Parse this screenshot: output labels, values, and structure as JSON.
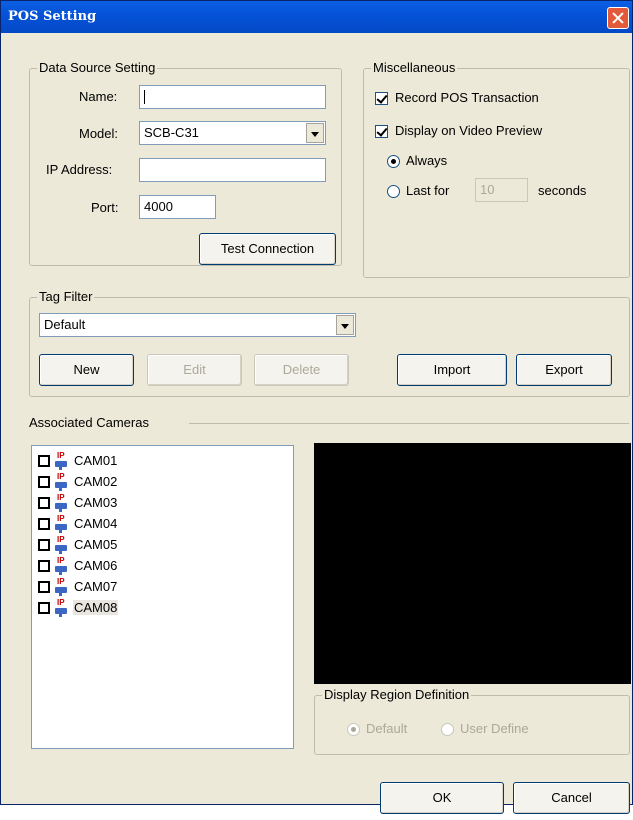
{
  "window": {
    "title": "POS Setting"
  },
  "data_source": {
    "legend": "Data Source Setting",
    "name_label": "Name:",
    "name_value": "",
    "model_label": "Model:",
    "model_value": "SCB-C31",
    "ip_label": "IP Address:",
    "ip_value": "",
    "port_label": "Port:",
    "port_value": "4000",
    "test_button": "Test Connection"
  },
  "misc": {
    "legend": "Miscellaneous",
    "record_pos": {
      "label": "Record POS Transaction",
      "checked": true
    },
    "display_preview": {
      "label": "Display on Video Preview",
      "checked": true
    },
    "always": {
      "label": "Always",
      "checked": true
    },
    "last_for": {
      "label": "Last for",
      "checked": false
    },
    "seconds_value": "10",
    "seconds_label": "seconds"
  },
  "tag_filter": {
    "legend": "Tag Filter",
    "selected": "Default",
    "new_button": "New",
    "edit_button": "Edit",
    "delete_button": "Delete",
    "import_button": "Import",
    "export_button": "Export"
  },
  "associated": {
    "label": "Associated Cameras",
    "cameras": [
      {
        "label": "CAM01",
        "checked": false
      },
      {
        "label": "CAM02",
        "checked": false
      },
      {
        "label": "CAM03",
        "checked": false
      },
      {
        "label": "CAM04",
        "checked": false
      },
      {
        "label": "CAM05",
        "checked": false
      },
      {
        "label": "CAM06",
        "checked": false
      },
      {
        "label": "CAM07",
        "checked": false
      },
      {
        "label": "CAM08",
        "checked": false,
        "selected": true
      }
    ],
    "camera_icon_text": "IP"
  },
  "region": {
    "legend": "Display Region Definition",
    "default_label": "Default",
    "user_define_label": "User Define"
  },
  "footer": {
    "ok": "OK",
    "cancel": "Cancel"
  },
  "colors": {
    "titlebar": "#0553d8",
    "window_bg": "#ece9d8",
    "preview_bg": "#000000"
  }
}
